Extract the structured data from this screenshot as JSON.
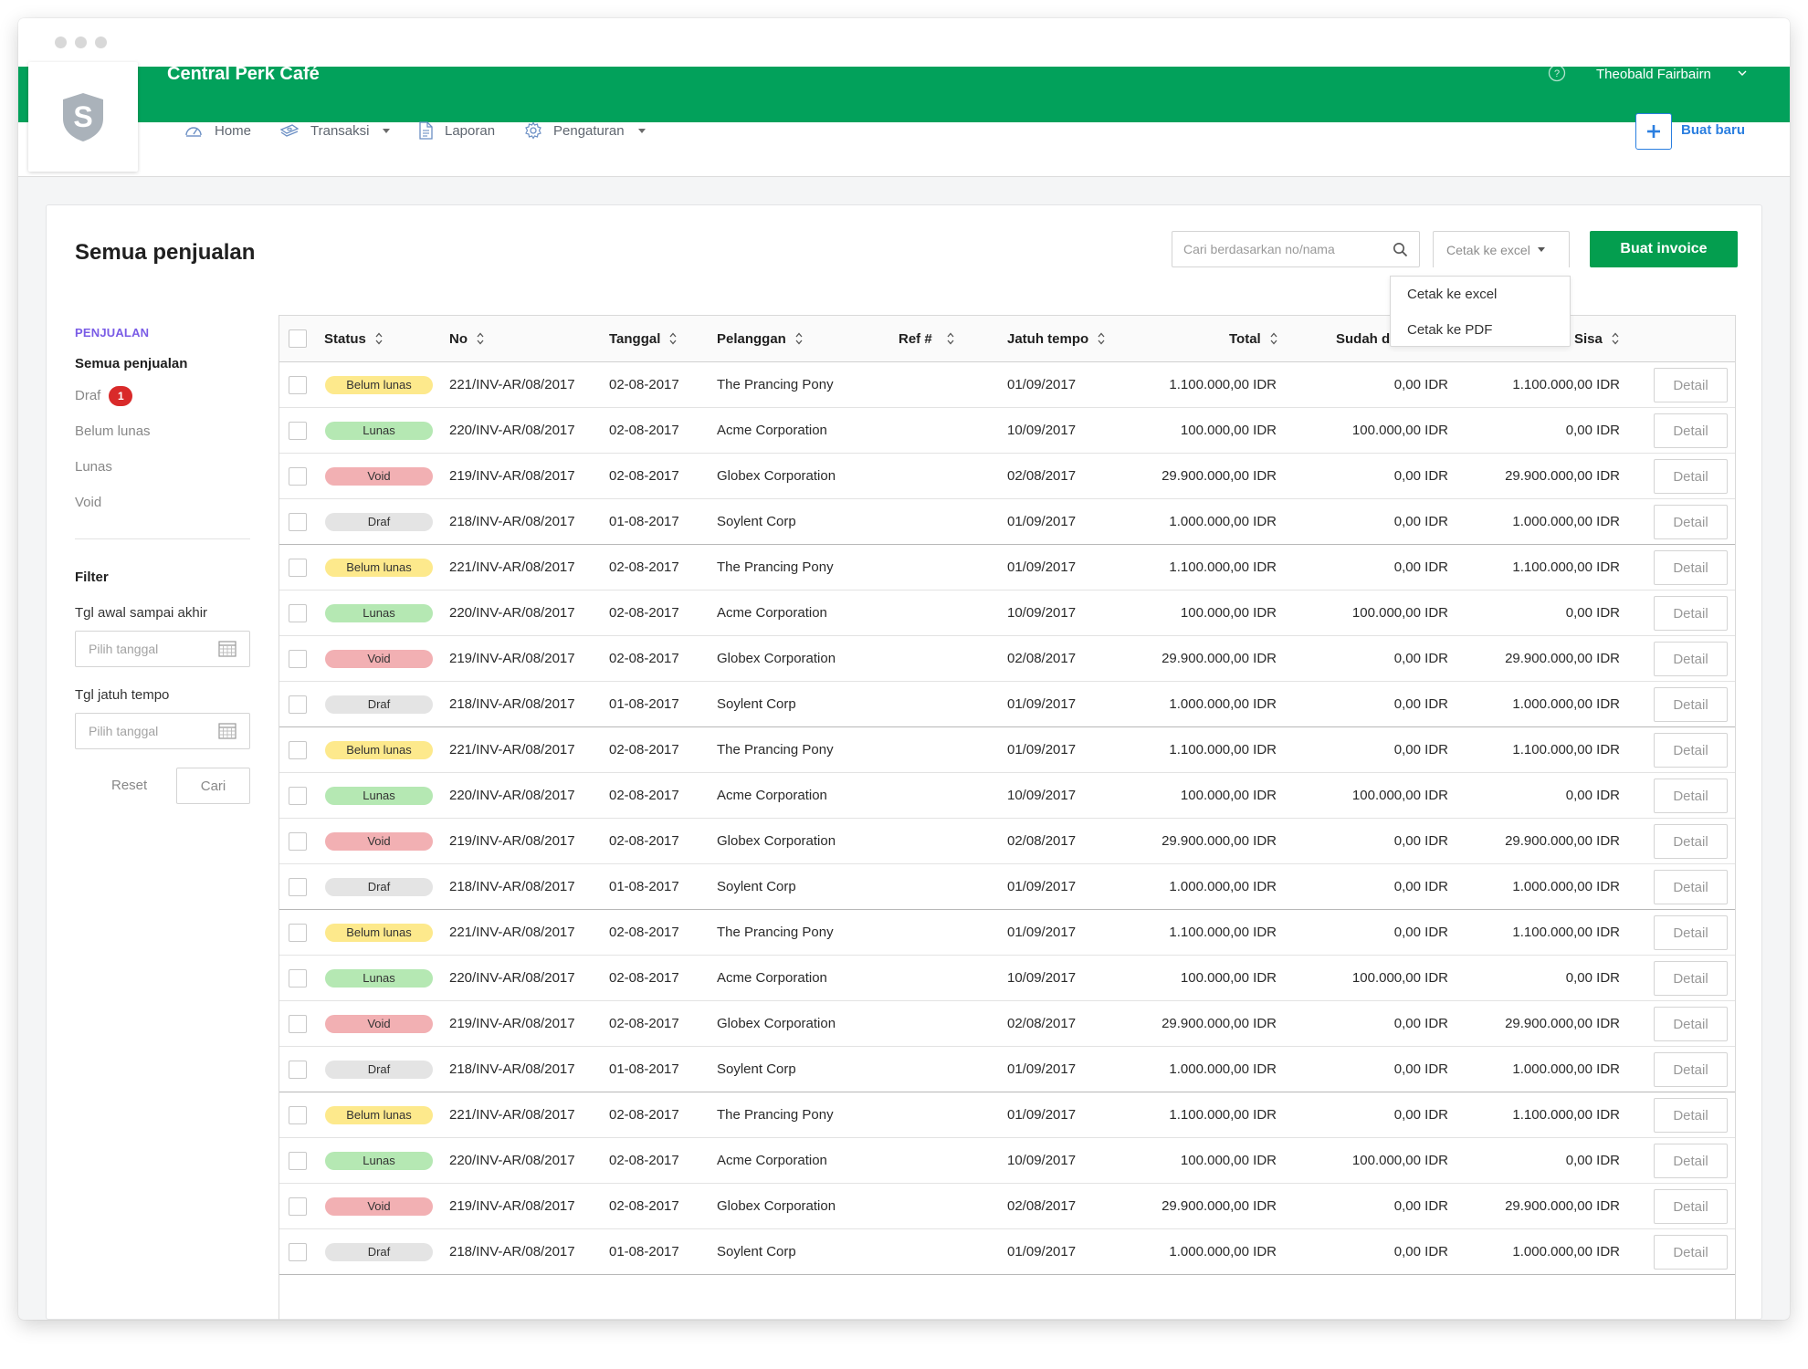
{
  "window": {
    "dots": [
      "#d8d8d8",
      "#d8d8d8",
      "#d8d8d8"
    ]
  },
  "app": {
    "title": "Central Perk Café",
    "brand_color": "#02a15b",
    "logo_icon": "shield-s-logo"
  },
  "user": {
    "name": "Theobald Fairbairn"
  },
  "nav": {
    "home": "Home",
    "transaksi": "Transaksi",
    "laporan": "Laporan",
    "pengaturan": "Pengaturan",
    "new_label": "Buat baru"
  },
  "page": {
    "title": "Semua penjualan"
  },
  "search": {
    "placeholder": "Cari berdasarkan no/nama"
  },
  "export": {
    "label": "Cetak ke excel",
    "options": [
      "Cetak ke excel",
      "Cetak ke PDF"
    ]
  },
  "invoice_button": "Buat invoice",
  "sidebar": {
    "section": "PENJUALAN",
    "items": [
      {
        "label": "Semua penjualan"
      },
      {
        "label": "Draf",
        "badge": "1"
      },
      {
        "label": "Belum lunas"
      },
      {
        "label": "Lunas"
      },
      {
        "label": "Void"
      }
    ],
    "filter": {
      "title": "Filter",
      "range_label": "Tgl awal sampai akhir",
      "due_label": "Tgl jatuh tempo",
      "date_placeholder": "Pilih tanggal",
      "reset": "Reset",
      "search": "Cari"
    }
  },
  "table": {
    "columns": {
      "status": "Status",
      "no": "No",
      "tanggal": "Tanggal",
      "pelanggan": "Pelanggan",
      "ref": "Ref #",
      "jatuh_tempo": "Jatuh tempo",
      "total": "Total",
      "sudah": "Sudah d",
      "sisa": "Sisa"
    },
    "detail_label": "Detail",
    "status_colors": {
      "Belum lunas": "#fde98c",
      "Lunas": "#b5e8b3",
      "Void": "#f2b0b3",
      "Draf": "#e4e4e4"
    },
    "rows": [
      {
        "status": "Belum lunas",
        "no": "221/INV-AR/08/2017",
        "tanggal": "02-08-2017",
        "pelanggan": "The Prancing Pony",
        "ref": "",
        "jatuh_tempo": "01/09/2017",
        "total": "1.100.000,00 IDR",
        "sudah": "0,00 IDR",
        "sisa": "1.100.000,00 IDR"
      },
      {
        "status": "Lunas",
        "no": "220/INV-AR/08/2017",
        "tanggal": "02-08-2017",
        "pelanggan": "Acme Corporation",
        "ref": "",
        "jatuh_tempo": "10/09/2017",
        "total": "100.000,00 IDR",
        "sudah": "100.000,00 IDR",
        "sisa": "0,00 IDR"
      },
      {
        "status": "Void",
        "no": "219/INV-AR/08/2017",
        "tanggal": "02-08-2017",
        "pelanggan": "Globex Corporation",
        "ref": "",
        "jatuh_tempo": "02/08/2017",
        "total": "29.900.000,00 IDR",
        "sudah": "0,00 IDR",
        "sisa": "29.900.000,00 IDR"
      },
      {
        "status": "Draf",
        "no": "218/INV-AR/08/2017",
        "tanggal": "01-08-2017",
        "pelanggan": "Soylent Corp",
        "ref": "",
        "jatuh_tempo": "01/09/2017",
        "total": "1.000.000,00 IDR",
        "sudah": "0,00 IDR",
        "sisa": "1.000.000,00 IDR"
      },
      {
        "status": "Belum lunas",
        "no": "221/INV-AR/08/2017",
        "tanggal": "02-08-2017",
        "pelanggan": "The Prancing Pony",
        "ref": "",
        "jatuh_tempo": "01/09/2017",
        "total": "1.100.000,00 IDR",
        "sudah": "0,00 IDR",
        "sisa": "1.100.000,00 IDR"
      },
      {
        "status": "Lunas",
        "no": "220/INV-AR/08/2017",
        "tanggal": "02-08-2017",
        "pelanggan": "Acme Corporation",
        "ref": "",
        "jatuh_tempo": "10/09/2017",
        "total": "100.000,00 IDR",
        "sudah": "100.000,00 IDR",
        "sisa": "0,00 IDR"
      },
      {
        "status": "Void",
        "no": "219/INV-AR/08/2017",
        "tanggal": "02-08-2017",
        "pelanggan": "Globex Corporation",
        "ref": "",
        "jatuh_tempo": "02/08/2017",
        "total": "29.900.000,00 IDR",
        "sudah": "0,00 IDR",
        "sisa": "29.900.000,00 IDR"
      },
      {
        "status": "Draf",
        "no": "218/INV-AR/08/2017",
        "tanggal": "01-08-2017",
        "pelanggan": "Soylent Corp",
        "ref": "",
        "jatuh_tempo": "01/09/2017",
        "total": "1.000.000,00 IDR",
        "sudah": "0,00 IDR",
        "sisa": "1.000.000,00 IDR"
      },
      {
        "status": "Belum lunas",
        "no": "221/INV-AR/08/2017",
        "tanggal": "02-08-2017",
        "pelanggan": "The Prancing Pony",
        "ref": "",
        "jatuh_tempo": "01/09/2017",
        "total": "1.100.000,00 IDR",
        "sudah": "0,00 IDR",
        "sisa": "1.100.000,00 IDR"
      },
      {
        "status": "Lunas",
        "no": "220/INV-AR/08/2017",
        "tanggal": "02-08-2017",
        "pelanggan": "Acme Corporation",
        "ref": "",
        "jatuh_tempo": "10/09/2017",
        "total": "100.000,00 IDR",
        "sudah": "100.000,00 IDR",
        "sisa": "0,00 IDR"
      },
      {
        "status": "Void",
        "no": "219/INV-AR/08/2017",
        "tanggal": "02-08-2017",
        "pelanggan": "Globex Corporation",
        "ref": "",
        "jatuh_tempo": "02/08/2017",
        "total": "29.900.000,00 IDR",
        "sudah": "0,00 IDR",
        "sisa": "29.900.000,00 IDR"
      },
      {
        "status": "Draf",
        "no": "218/INV-AR/08/2017",
        "tanggal": "01-08-2017",
        "pelanggan": "Soylent Corp",
        "ref": "",
        "jatuh_tempo": "01/09/2017",
        "total": "1.000.000,00 IDR",
        "sudah": "0,00 IDR",
        "sisa": "1.000.000,00 IDR"
      },
      {
        "status": "Belum lunas",
        "no": "221/INV-AR/08/2017",
        "tanggal": "02-08-2017",
        "pelanggan": "The Prancing Pony",
        "ref": "",
        "jatuh_tempo": "01/09/2017",
        "total": "1.100.000,00 IDR",
        "sudah": "0,00 IDR",
        "sisa": "1.100.000,00 IDR"
      },
      {
        "status": "Lunas",
        "no": "220/INV-AR/08/2017",
        "tanggal": "02-08-2017",
        "pelanggan": "Acme Corporation",
        "ref": "",
        "jatuh_tempo": "10/09/2017",
        "total": "100.000,00 IDR",
        "sudah": "100.000,00 IDR",
        "sisa": "0,00 IDR"
      },
      {
        "status": "Void",
        "no": "219/INV-AR/08/2017",
        "tanggal": "02-08-2017",
        "pelanggan": "Globex Corporation",
        "ref": "",
        "jatuh_tempo": "02/08/2017",
        "total": "29.900.000,00 IDR",
        "sudah": "0,00 IDR",
        "sisa": "29.900.000,00 IDR"
      },
      {
        "status": "Draf",
        "no": "218/INV-AR/08/2017",
        "tanggal": "01-08-2017",
        "pelanggan": "Soylent Corp",
        "ref": "",
        "jatuh_tempo": "01/09/2017",
        "total": "1.000.000,00 IDR",
        "sudah": "0,00 IDR",
        "sisa": "1.000.000,00 IDR"
      },
      {
        "status": "Belum lunas",
        "no": "221/INV-AR/08/2017",
        "tanggal": "02-08-2017",
        "pelanggan": "The Prancing Pony",
        "ref": "",
        "jatuh_tempo": "01/09/2017",
        "total": "1.100.000,00 IDR",
        "sudah": "0,00 IDR",
        "sisa": "1.100.000,00 IDR"
      },
      {
        "status": "Lunas",
        "no": "220/INV-AR/08/2017",
        "tanggal": "02-08-2017",
        "pelanggan": "Acme Corporation",
        "ref": "",
        "jatuh_tempo": "10/09/2017",
        "total": "100.000,00 IDR",
        "sudah": "100.000,00 IDR",
        "sisa": "0,00 IDR"
      },
      {
        "status": "Void",
        "no": "219/INV-AR/08/2017",
        "tanggal": "02-08-2017",
        "pelanggan": "Globex Corporation",
        "ref": "",
        "jatuh_tempo": "02/08/2017",
        "total": "29.900.000,00 IDR",
        "sudah": "0,00 IDR",
        "sisa": "29.900.000,00 IDR"
      },
      {
        "status": "Draf",
        "no": "218/INV-AR/08/2017",
        "tanggal": "01-08-2017",
        "pelanggan": "Soylent Corp",
        "ref": "",
        "jatuh_tempo": "01/09/2017",
        "total": "1.000.000,00 IDR",
        "sudah": "0,00 IDR",
        "sisa": "1.000.000,00 IDR"
      }
    ]
  }
}
